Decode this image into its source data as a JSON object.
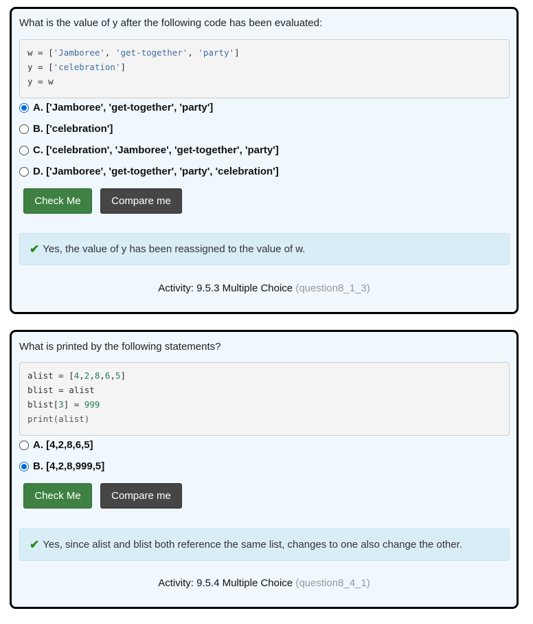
{
  "questions": [
    {
      "prompt": "What is the value of y after the following code has been evaluated:",
      "options": [
        "A. ['Jamboree', 'get-together', 'party']",
        "B. ['celebration']",
        "C. ['celebration', 'Jamboree', 'get-together', 'party']",
        "D. ['Jamboree', 'get-together', 'party', 'celebration']"
      ],
      "selected": 0,
      "check_label": "Check Me",
      "compare_label": "Compare me",
      "feedback": "Yes, the value of y has been reassigned to the value of w.",
      "activity": "Activity: 9.5.3 Multiple Choice",
      "activity_id": "(question8_1_3)"
    },
    {
      "prompt": "What is printed by the following statements?",
      "options": [
        "A. [4,2,8,6,5]",
        "B. [4,2,8,999,5]"
      ],
      "selected": 1,
      "check_label": "Check Me",
      "compare_label": "Compare me",
      "feedback": "Yes, since alist and blist both reference the same list, changes to one also change the other.",
      "activity": "Activity: 9.5.4 Multiple Choice",
      "activity_id": "(question8_4_1)"
    }
  ],
  "code": {
    "q1": {
      "l1a": "w = [",
      "l1b": "'Jamboree'",
      "l1c": ", ",
      "l1d": "'get-together'",
      "l1e": ", ",
      "l1f": "'party'",
      "l1g": "]",
      "l2a": "y = [",
      "l2b": "'celebration'",
      "l2c": "]",
      "l3": "y = w"
    },
    "q2": {
      "l1a": "alist = [",
      "l1b": "4",
      "l1c": ",",
      "l1d": "2",
      "l1e": ",",
      "l1f": "8",
      "l1g": ",",
      "l1h": "6",
      "l1i": ",",
      "l1j": "5",
      "l1k": "]",
      "l2": "blist = alist",
      "l3a": "blist[",
      "l3b": "3",
      "l3c": "] = ",
      "l3d": "999",
      "l4": "print(alist)"
    }
  }
}
